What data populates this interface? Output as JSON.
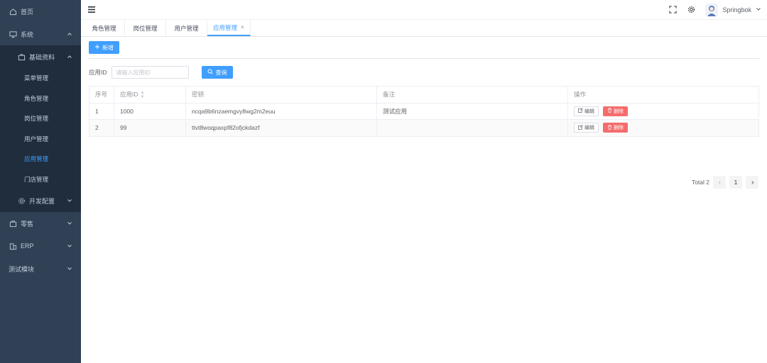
{
  "sidebar": {
    "items": [
      {
        "label": "首页",
        "icon": "home-icon"
      },
      {
        "label": "系统",
        "icon": "monitor-icon"
      },
      {
        "label": "基础资料",
        "icon": "briefcase-icon"
      },
      {
        "label": "开发配置",
        "icon": "gear-icon"
      },
      {
        "label": "零售",
        "icon": "bag-icon"
      },
      {
        "label": "ERP",
        "icon": "building-icon"
      },
      {
        "label": "测试模块",
        "icon": ""
      }
    ],
    "sub_items": [
      "菜单管理",
      "角色管理",
      "岗位管理",
      "用户管理",
      "应用管理",
      "门店管理"
    ],
    "active_sub": "应用管理"
  },
  "navbar": {
    "username": "Springbok"
  },
  "tabs": [
    {
      "label": "角色管理"
    },
    {
      "label": "岗位管理"
    },
    {
      "label": "用户管理"
    },
    {
      "label": "应用管理",
      "active": true,
      "close": "×"
    }
  ],
  "toolbar": {
    "add_label": "新增"
  },
  "filter": {
    "label": "应用ID",
    "placeholder": "请输入应用ID",
    "query_label": "查询"
  },
  "table": {
    "headers": [
      "序号",
      "应用ID",
      "密钥",
      "备注",
      "操作"
    ],
    "rows": [
      {
        "index": "1",
        "app_id": "1000",
        "secret": "ncqa9b6nzaemgvy8wg2m2euu",
        "remark": "测试应用"
      },
      {
        "index": "2",
        "app_id": "99",
        "secret": "ttvt8woqpaxpf82ofjckdazf",
        "remark": ""
      }
    ],
    "edit_label": "编辑",
    "delete_label": "删除"
  },
  "pagination": {
    "total": "Total 2",
    "current": "1"
  },
  "colors": {
    "sidebar_bg": "#304156",
    "submenu_bg": "#1f2d3d",
    "primary": "#409eff",
    "danger": "#f56c6c"
  }
}
